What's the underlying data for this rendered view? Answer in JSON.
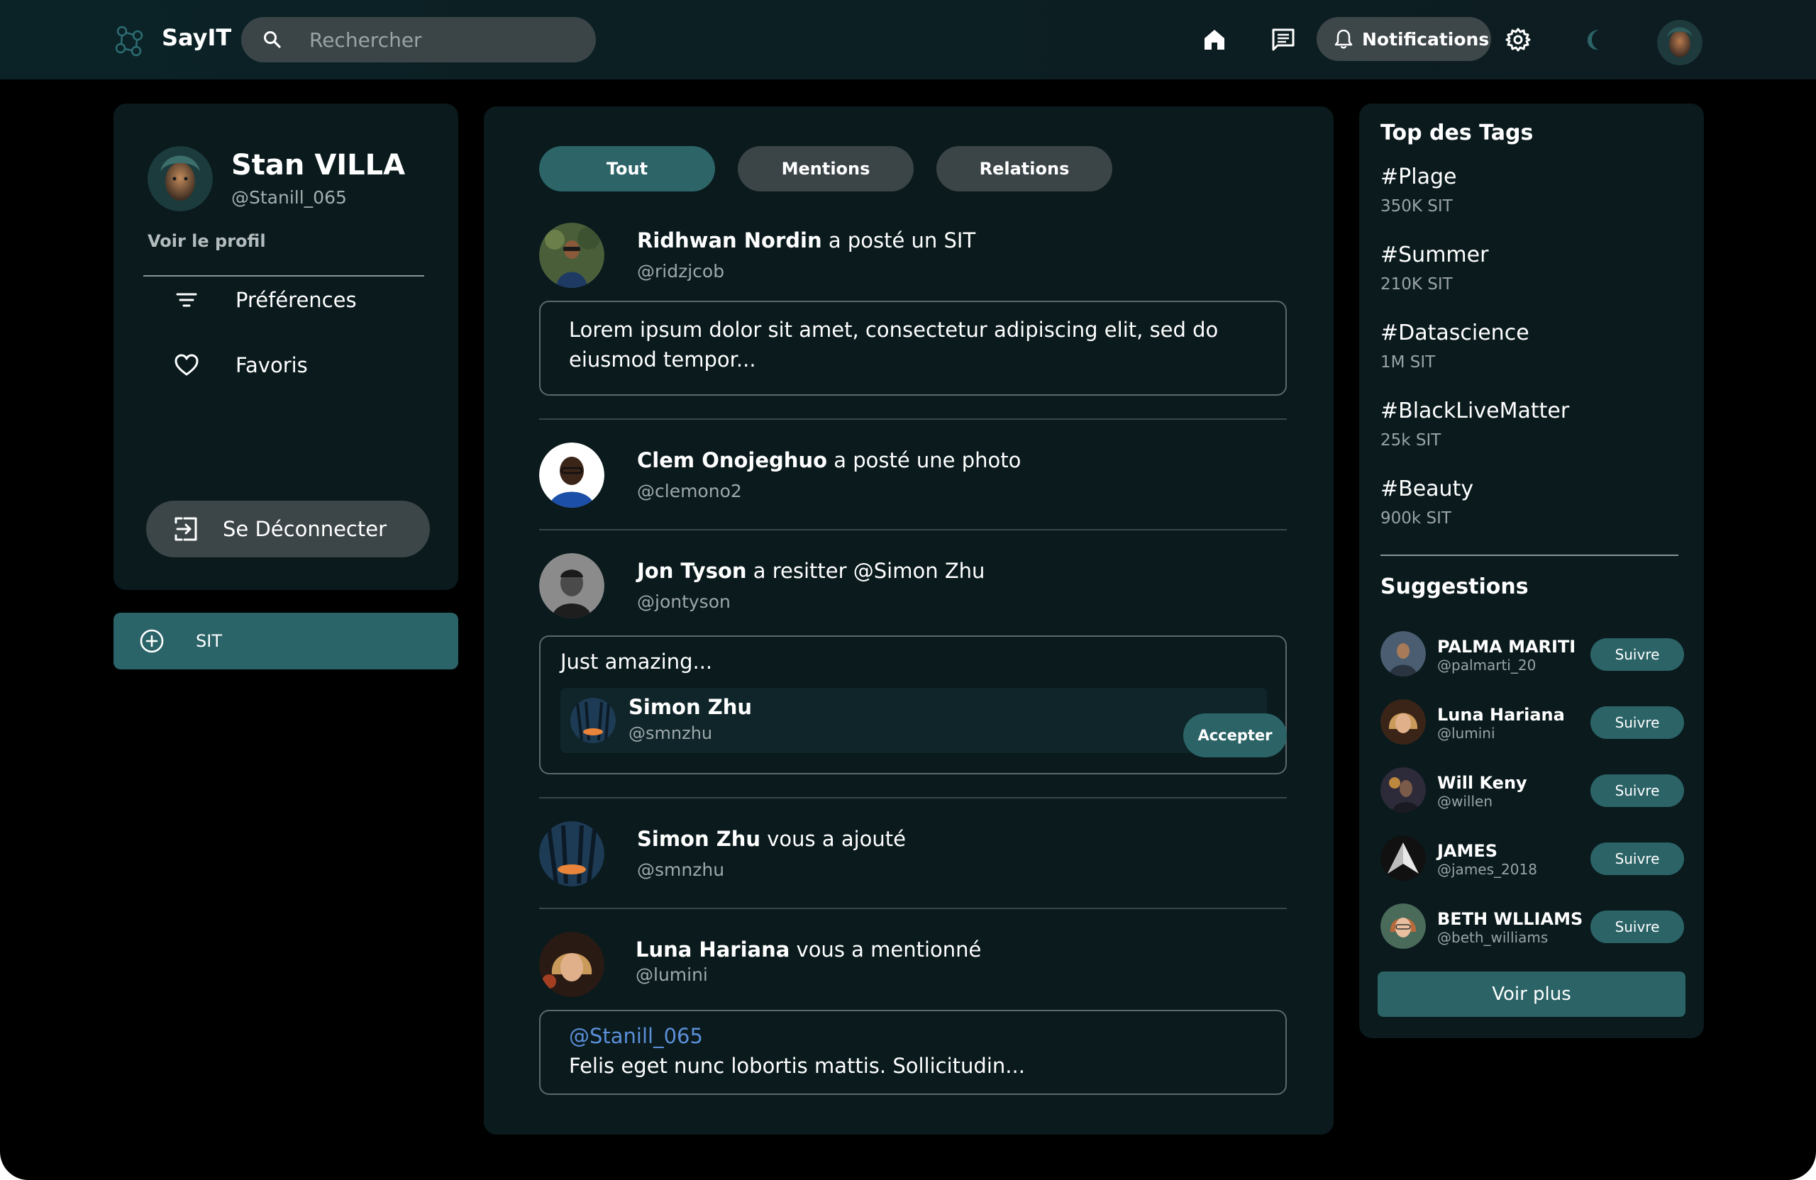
{
  "app": {
    "name": "SayIT"
  },
  "search": {
    "placeholder": "Rechercher"
  },
  "nav": {
    "notifications_label": "Notifications"
  },
  "profile": {
    "name": "Stan VILLA",
    "handle": "@Stanill_065",
    "view_profile": "Voir le profil",
    "menu": [
      {
        "label": "Préférences",
        "icon": "filter-icon"
      },
      {
        "label": "Favoris",
        "icon": "heart-icon"
      }
    ],
    "logout_label": "Se Déconnecter"
  },
  "compose": {
    "label": "SIT"
  },
  "tabs": [
    {
      "label": "Tout",
      "active": true
    },
    {
      "label": "Mentions",
      "active": false
    },
    {
      "label": "Relations",
      "active": false
    }
  ],
  "feed": [
    {
      "author": "Ridhwan Nordin",
      "action": "a posté un SIT",
      "handle": "@ridzjcob",
      "text": "Lorem ipsum dolor sit amet, consectetur adipiscing elit, sed do eiusmod tempor..."
    },
    {
      "author": "Clem Onojeghuo",
      "action": "a posté une photo",
      "handle": "@clemono2"
    },
    {
      "author": "Jon Tyson",
      "action": "a resitter @Simon Zhu",
      "handle": "@jontyson",
      "text": "Just amazing...",
      "quoted": {
        "name": "Simon Zhu",
        "handle": "@smnzhu"
      }
    },
    {
      "author": "Simon Zhu",
      "action": "vous a ajouté",
      "handle": "@smnzhu",
      "button": "Accepter"
    },
    {
      "author": "Luna Hariana",
      "action": "vous a mentionné",
      "handle": "@lumini",
      "mention": "@Stanill_065",
      "text": "Felis eget nunc lobortis mattis. Sollicitudin..."
    }
  ],
  "top_tags": {
    "title": "Top des Tags",
    "items": [
      {
        "tag": "#Plage",
        "count": "350K SIT"
      },
      {
        "tag": "#Summer",
        "count": "210K SIT"
      },
      {
        "tag": "#Datascience",
        "count": "1M SIT"
      },
      {
        "tag": "#BlackLiveMatter",
        "count": "25k SIT"
      },
      {
        "tag": "#Beauty",
        "count": "900k SIT"
      }
    ]
  },
  "suggestions": {
    "title": "Suggestions",
    "follow_label": "Suivre",
    "more_label": "Voir plus",
    "items": [
      {
        "name": "PALMA MARITI",
        "handle": "@palmarti_20"
      },
      {
        "name": "Luna Hariana",
        "handle": "@lumini"
      },
      {
        "name": "Will Keny",
        "handle": "@willen"
      },
      {
        "name": "JAMES",
        "handle": "@james_2018"
      },
      {
        "name": "BETH WLLIAMS",
        "handle": "@beth_williams"
      }
    ]
  },
  "colors": {
    "accent": "#2b6367",
    "panel": "#0a1a1d",
    "background": "#000000",
    "mention": "#5b8fd8"
  }
}
